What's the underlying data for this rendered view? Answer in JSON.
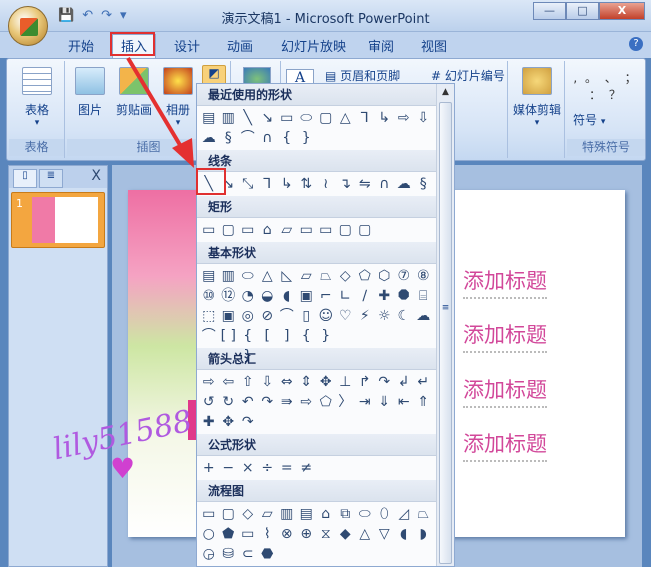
{
  "window": {
    "title": "演示文稿1 - Microsoft PowerPoint",
    "min": "—",
    "max": "□",
    "close": "X"
  },
  "qat": {
    "save": "💾",
    "undo": "↶",
    "redo": "↷",
    "more": "▾"
  },
  "tabs": [
    "开始",
    "插入",
    "设计",
    "动画",
    "幻灯片放映",
    "审阅",
    "视图"
  ],
  "active_tab": "插入",
  "help": "?",
  "ribbon": {
    "table": {
      "label": "表格",
      "arrow": "▾",
      "group": "表格"
    },
    "picture": "图片",
    "clipart": "剪贴画",
    "album": "相册",
    "album_arrow": "▾",
    "illustrations_group": "插图",
    "textbox_icon": "A",
    "header_footer": "页眉和页脚",
    "slide_number": "幻灯片编号",
    "media": {
      "label": "媒体剪辑",
      "arrow": "▾"
    },
    "symbol": {
      "label": "符号",
      "arrow": "▾",
      "chars": ", 。 、 ； ： ？",
      "group": "特殊符号"
    }
  },
  "left_pane": {
    "close": "X",
    "slide_number": "1"
  },
  "slide": {
    "titles": [
      "添加标题",
      "添加标题",
      "添加标题",
      "添加标题"
    ]
  },
  "watermark": "lily51588",
  "shapes_menu": {
    "sections": [
      {
        "title": "最近使用的形状",
        "shapes": [
          "▤",
          "▥",
          "╲",
          "↘",
          "▭",
          "⬭",
          "▢",
          "△",
          "⅂",
          "↳",
          "⇨",
          "⇩",
          "☁",
          "§",
          "⌒",
          "∩",
          "{",
          "}"
        ]
      },
      {
        "title": "线条",
        "shapes": [
          "╲",
          "↘",
          "⤡",
          "⅂",
          "↳",
          "⇅",
          "≀",
          "↴",
          "⇋",
          "∩",
          "☁",
          "§"
        ]
      },
      {
        "title": "矩形",
        "shapes": [
          "▭",
          "▢",
          "▭",
          "⌂",
          "▱",
          "▭",
          "▭",
          "▢",
          "▢"
        ]
      },
      {
        "title": "基本形状",
        "shapes": [
          "▤",
          "▥",
          "⬭",
          "△",
          "◺",
          "▱",
          "⏢",
          "◇",
          "⬠",
          "⬡",
          "⑦",
          "⑧",
          "⑩",
          "⑫",
          "◔",
          "◒",
          "◖",
          "▣",
          "⌐",
          "∟",
          "∕",
          "✚",
          "⯃",
          "⌸",
          "⬚",
          "▣",
          "◎",
          "⊘",
          "⌒",
          "▯",
          "☺",
          "♡",
          "⚡",
          "☼",
          "☾",
          "☁",
          "⌒",
          "[ ]",
          "{ }",
          "[",
          "]",
          "{",
          "}"
        ]
      },
      {
        "title": "箭头总汇",
        "shapes": [
          "⇨",
          "⇦",
          "⇧",
          "⇩",
          "⇔",
          "⇕",
          "✥",
          "⊥",
          "↱",
          "↷",
          "↲",
          "↵",
          "↺",
          "↻",
          "↶",
          "↷",
          "⇛",
          "⇨",
          "⬠",
          "〉",
          "⇥",
          "⇓",
          "⇤",
          "⇑",
          "✚",
          "✥",
          "↷"
        ]
      },
      {
        "title": "公式形状",
        "shapes": [
          "+",
          "−",
          "×",
          "÷",
          "=",
          "≠"
        ]
      },
      {
        "title": "流程图",
        "shapes": [
          "▭",
          "▢",
          "◇",
          "▱",
          "▥",
          "▤",
          "⌂",
          "⧉",
          "⬭",
          "⬯",
          "◿",
          "⏢",
          "○",
          "⬟",
          "▭",
          "⌇",
          "⊗",
          "⊕",
          "⧖",
          "◆",
          "△",
          "▽",
          "◖",
          "◗",
          "◶",
          "⛁",
          "⊂",
          "⬣"
        ]
      },
      {
        "title": "星与旗帜",
        "shapes": []
      }
    ],
    "scroll_up": "▲",
    "scroll_grip": "≡"
  }
}
